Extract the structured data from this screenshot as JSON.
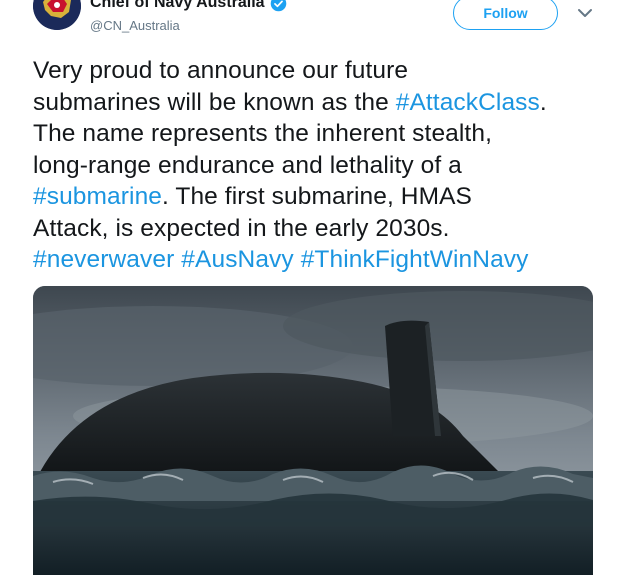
{
  "account": {
    "display_name": "Chief of Navy Australia",
    "screen_name": "@CN_Australia",
    "avatar_icon": "navy-crest-icon",
    "verified_icon": "verified-badge-icon"
  },
  "actions": {
    "follow_label": "Follow",
    "menu_icon": "chevron-down-icon"
  },
  "tweet": {
    "lines": [
      [
        {
          "t": "Very proud to announce our future",
          "h": false
        }
      ],
      [
        {
          "t": "submarines will be known as the ",
          "h": false
        },
        {
          "t": "#AttackClass",
          "h": true
        },
        {
          "t": ".",
          "h": false
        }
      ],
      [
        {
          "t": "The name represents the inherent stealth,",
          "h": false
        }
      ],
      [
        {
          "t": "long-range endurance and lethality of a",
          "h": false
        }
      ],
      [
        {
          "t": "#submarine",
          "h": true
        },
        {
          "t": ". The first submarine, HMAS",
          "h": false
        }
      ],
      [
        {
          "t": "Attack, is expected in the early 2030s.",
          "h": false
        }
      ],
      [
        {
          "t": "#neverwaver",
          "h": true
        },
        {
          "t": " ",
          "h": false
        },
        {
          "t": "#AusNavy",
          "h": true
        },
        {
          "t": " ",
          "h": false
        },
        {
          "t": "#ThinkFightWinNavy",
          "h": true
        }
      ]
    ]
  },
  "colors": {
    "link": "#1b95e0",
    "follow": "#1da1f2",
    "text": "#14171a",
    "secondary": "#657786"
  }
}
